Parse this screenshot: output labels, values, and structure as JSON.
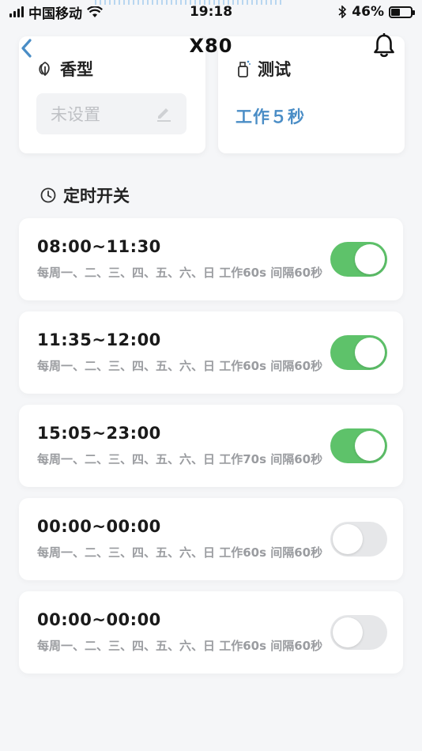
{
  "status_bar": {
    "carrier": "中国移动",
    "time": "19:18",
    "battery": "46%",
    "battery_level": 0.46
  },
  "nav": {
    "title": "X80",
    "back_icon": "chevron-left-icon",
    "bell_icon": "bell-icon"
  },
  "scent_card": {
    "label": "香型",
    "value": "未设置",
    "icon": "leaf-icon",
    "edit_icon": "pencil-icon"
  },
  "test_card": {
    "label": "测试",
    "value": "工作５秒",
    "icon": "spray-bottle-icon"
  },
  "timer_section": {
    "title": "定时开关",
    "icon": "clock-icon"
  },
  "timers": [
    {
      "time": "08:00~11:30",
      "desc": "每周一、二、三、四、五、六、日 工作60s 间隔60秒",
      "enabled": true
    },
    {
      "time": "11:35~12:00",
      "desc": "每周一、二、三、四、五、六、日 工作60s 间隔60秒",
      "enabled": true
    },
    {
      "time": "15:05~23:00",
      "desc": "每周一、二、三、四、五、六、日 工作70s 间隔60秒",
      "enabled": true
    },
    {
      "time": "00:00~00:00",
      "desc": "每周一、二、三、四、五、六、日 工作60s 间隔60秒",
      "enabled": false
    },
    {
      "time": "00:00~00:00",
      "desc": "每周一、二、三、四、五、六、日 工作60s 间隔60秒",
      "enabled": false
    }
  ],
  "colors": {
    "accent_blue": "#4a8dc6",
    "toggle_on": "#5ec26a",
    "toggle_off": "#e6e7e9"
  }
}
